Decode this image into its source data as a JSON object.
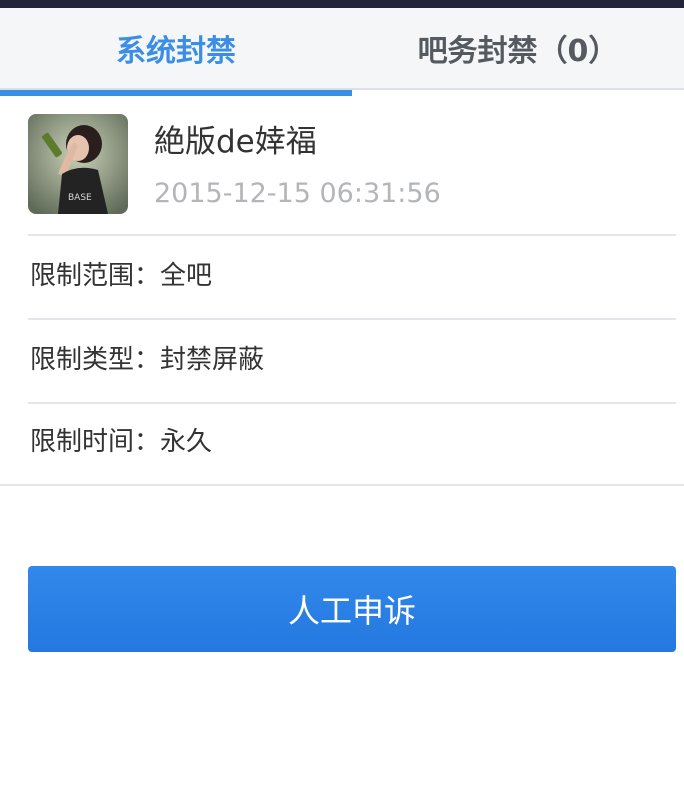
{
  "tabs": [
    {
      "label": "系统封禁",
      "active": true
    },
    {
      "label": "吧务封禁（0）",
      "active": false
    }
  ],
  "colors": {
    "accent": "#3a8ee6",
    "top_bar": "#22253a",
    "tab_bg": "#f5f6f8",
    "button": "#2a7fe6"
  },
  "user": {
    "name": "絶版de婞福",
    "time": "2015-12-15 06:31:56",
    "avatar_icon": "user-avatar-photo"
  },
  "details": {
    "scope": "限制范围：全吧",
    "type": "限制类型：封禁屏蔽",
    "duration": "限制时间：永久"
  },
  "appeal_button_label": "人工申诉"
}
